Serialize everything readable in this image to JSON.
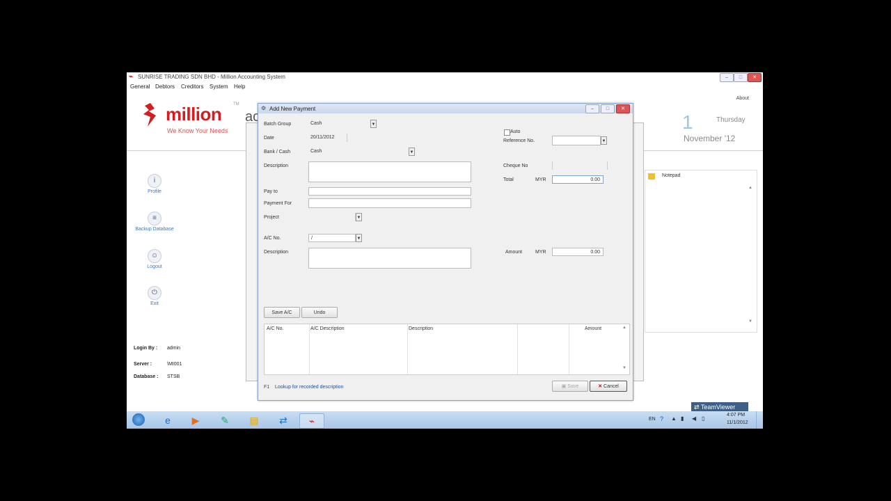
{
  "app": {
    "title": "SUNRISE TRADING SDN BHD - Million Accounting System",
    "menu": [
      "General",
      "Debtors",
      "Creditors",
      "System",
      "Help"
    ],
    "about": "About",
    "brand": {
      "name": "million",
      "tagline": "We Know Your Needs",
      "tm": "TM",
      "partial": "ac"
    },
    "date": {
      "day_num": "1",
      "weekday": "Thursday",
      "month": "November '12"
    }
  },
  "sidebar": {
    "items": [
      {
        "label": "Profile",
        "icon": "info-icon"
      },
      {
        "label": "Backup Database",
        "icon": "database-icon"
      },
      {
        "label": "Logout",
        "icon": "user-icon"
      },
      {
        "label": "Exit",
        "icon": "power-icon"
      }
    ],
    "login": {
      "label": "Login By :",
      "value": "admin"
    },
    "server": {
      "label": "Server :",
      "value": "\\MI001"
    },
    "database": {
      "label": "Database :",
      "value": "STSB"
    }
  },
  "notepad": {
    "label": "Notepad"
  },
  "dialog": {
    "title": "Add New Payment",
    "batch_group": {
      "label": "Batch Group",
      "value": "Cash"
    },
    "date": {
      "label": "Date",
      "value": "20/11/2012"
    },
    "bank_cash": {
      "label": "Bank / Cash",
      "value": "Cash"
    },
    "description": {
      "label": "Description",
      "value": ""
    },
    "pay_to": {
      "label": "Pay to",
      "value": ""
    },
    "payment_for": {
      "label": "Payment For",
      "value": ""
    },
    "project": {
      "label": "Project",
      "value": ""
    },
    "ac_no": {
      "label": "A/C No.",
      "value": "/"
    },
    "description2": {
      "label": "Description",
      "value": ""
    },
    "auto": {
      "label": "Auto"
    },
    "reference_no": {
      "label": "Reference No.",
      "value": ""
    },
    "cheque_no": {
      "label": "Cheque No",
      "value": ""
    },
    "total": {
      "label": "Total",
      "currency": "MYR",
      "value": "0.00"
    },
    "amount": {
      "label": "Amount",
      "currency": "MYR",
      "value": "0.00"
    },
    "save_ac": "Save A/C",
    "undo": "Undo",
    "grid": {
      "columns": [
        "A/C No.",
        "A/C Description",
        "Description",
        "Amount"
      ]
    },
    "hint": {
      "key": "F1",
      "text": "Lookup for recorded description"
    },
    "save": "Save",
    "cancel": "Cancel"
  },
  "taskbar": {
    "lang": "EN",
    "time": "4:07 PM",
    "date": "11/1/2012",
    "teamviewer": "TeamViewer"
  },
  "colors": {
    "brand": "#d21e1e",
    "link": "#3a78c3",
    "dialog_border": "#8aa4c7"
  }
}
